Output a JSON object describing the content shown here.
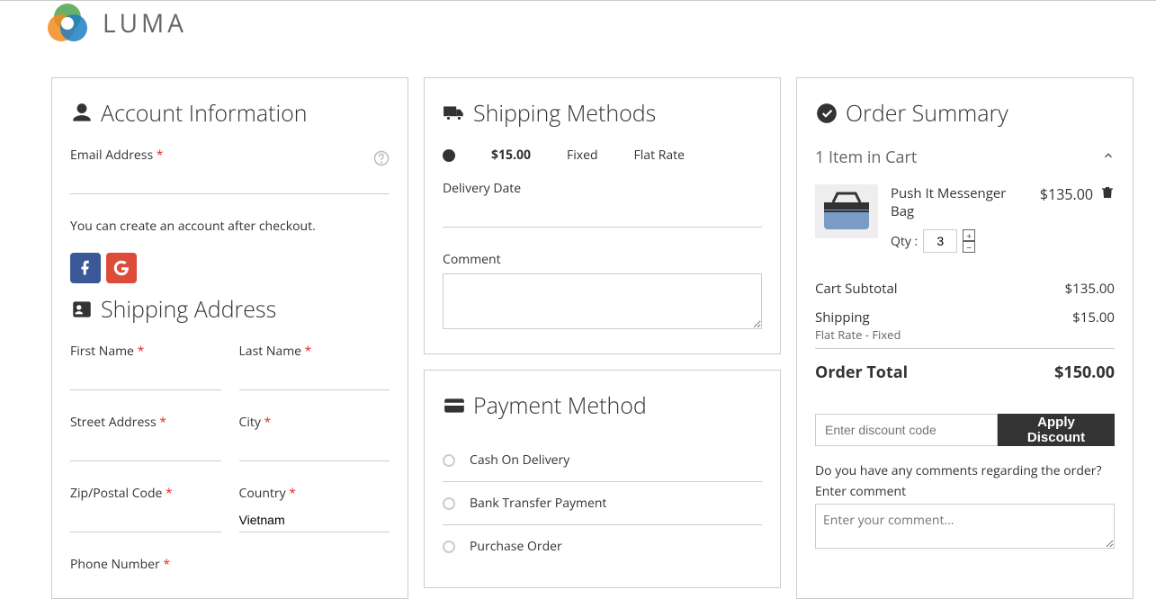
{
  "brand": "LUMA",
  "account": {
    "heading": "Account Information",
    "email_label": "Email Address",
    "hint": "You can create an account after checkout."
  },
  "shipping_address": {
    "heading": "Shipping Address",
    "first_name": "First Name",
    "last_name": "Last Name",
    "street": "Street Address",
    "city": "City",
    "zip": "Zip/Postal Code",
    "country_label": "Country",
    "country_value": "Vietnam",
    "phone": "Phone Number"
  },
  "shipping_methods": {
    "heading": "Shipping Methods",
    "price": "$15.00",
    "carrier": "Fixed",
    "method": "Flat Rate",
    "delivery_date_label": "Delivery Date",
    "comment_label": "Comment"
  },
  "payment": {
    "heading": "Payment Method",
    "options": [
      "Cash On Delivery",
      "Bank Transfer Payment",
      "Purchase Order"
    ]
  },
  "summary": {
    "heading": "Order Summary",
    "cart_count": "1 Item in Cart",
    "item": {
      "name": "Push It Messenger Bag",
      "price": "$135.00",
      "qty_label": "Qty :",
      "qty": "3"
    },
    "subtotal_label": "Cart Subtotal",
    "subtotal": "$135.00",
    "shipping_label": "Shipping",
    "shipping": "$15.00",
    "shipping_sub": "Flat Rate - Fixed",
    "total_label": "Order Total",
    "total": "$150.00",
    "discount_placeholder": "Enter discount code",
    "discount_btn": "Apply Discount",
    "comment_q": "Do you have any comments regarding the order?",
    "comment_sub": "Enter comment",
    "comment_placeholder": "Enter your comment..."
  }
}
